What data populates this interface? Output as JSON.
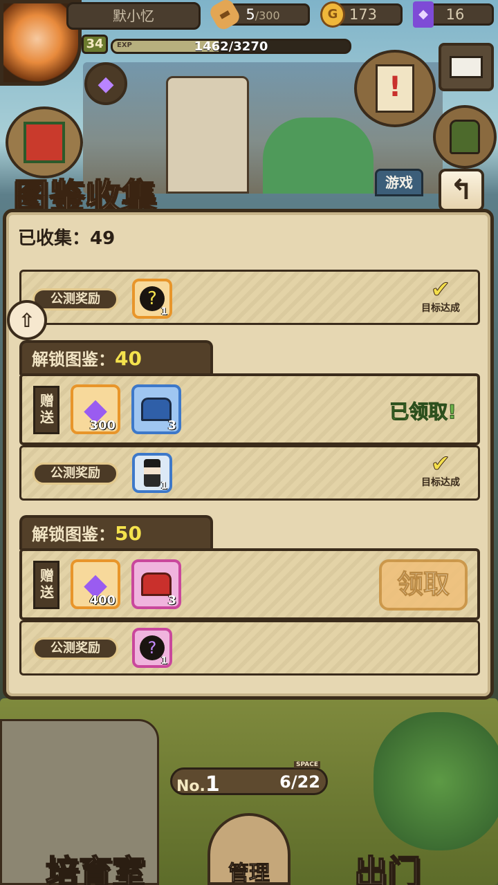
{
  "hud": {
    "player_name": "默小忆",
    "bread": "5",
    "bread_max": "/300",
    "gold": "173",
    "gems": "16",
    "level": "34",
    "exp_tag": "EXP",
    "exp_text": "1462/3270",
    "exp_fraction": 0.447
  },
  "scene_tab": "游戏",
  "panel": {
    "title": "图鉴收集",
    "collected_label": "已收集：49",
    "gift_label": "赠送",
    "obt_label": "公测奖励",
    "done_label": "目标达成",
    "claimed_label": "已领取!",
    "claim_button": "领取",
    "tiers": [
      {
        "head": "解锁图鉴：",
        "num": "40",
        "gift_items": [
          {
            "icon": "purple-gem-icon",
            "count": "300"
          },
          {
            "icon": "blue-chest-icon",
            "count": "3"
          }
        ],
        "obt_item": {
          "icon": "top-hat-character-icon",
          "count": "1"
        }
      },
      {
        "head": "解锁图鉴：",
        "num": "50",
        "gift_items": [
          {
            "icon": "purple-gem-icon",
            "count": "400"
          },
          {
            "icon": "red-chest-icon",
            "count": "3"
          }
        ],
        "obt_item": {
          "icon": "mystery-silhouette-icon",
          "count": "1"
        }
      }
    ],
    "prev_obt_item": {
      "icon": "mystery-silhouette-icon",
      "count": "1"
    }
  },
  "bottom": {
    "no_label": "No.",
    "no_value": "1",
    "space_label": "SPACE",
    "space_value": "6/22",
    "left_button": "培育室",
    "center_button": "管理",
    "right_button": "出门"
  },
  "colors": {
    "panel_bg": "#e6d7b2",
    "border_dark": "#3b2c1a",
    "highlight_yellow": "#f4e24d",
    "claimed_green": "#6db34a",
    "claim_button": "#f0c07a"
  }
}
